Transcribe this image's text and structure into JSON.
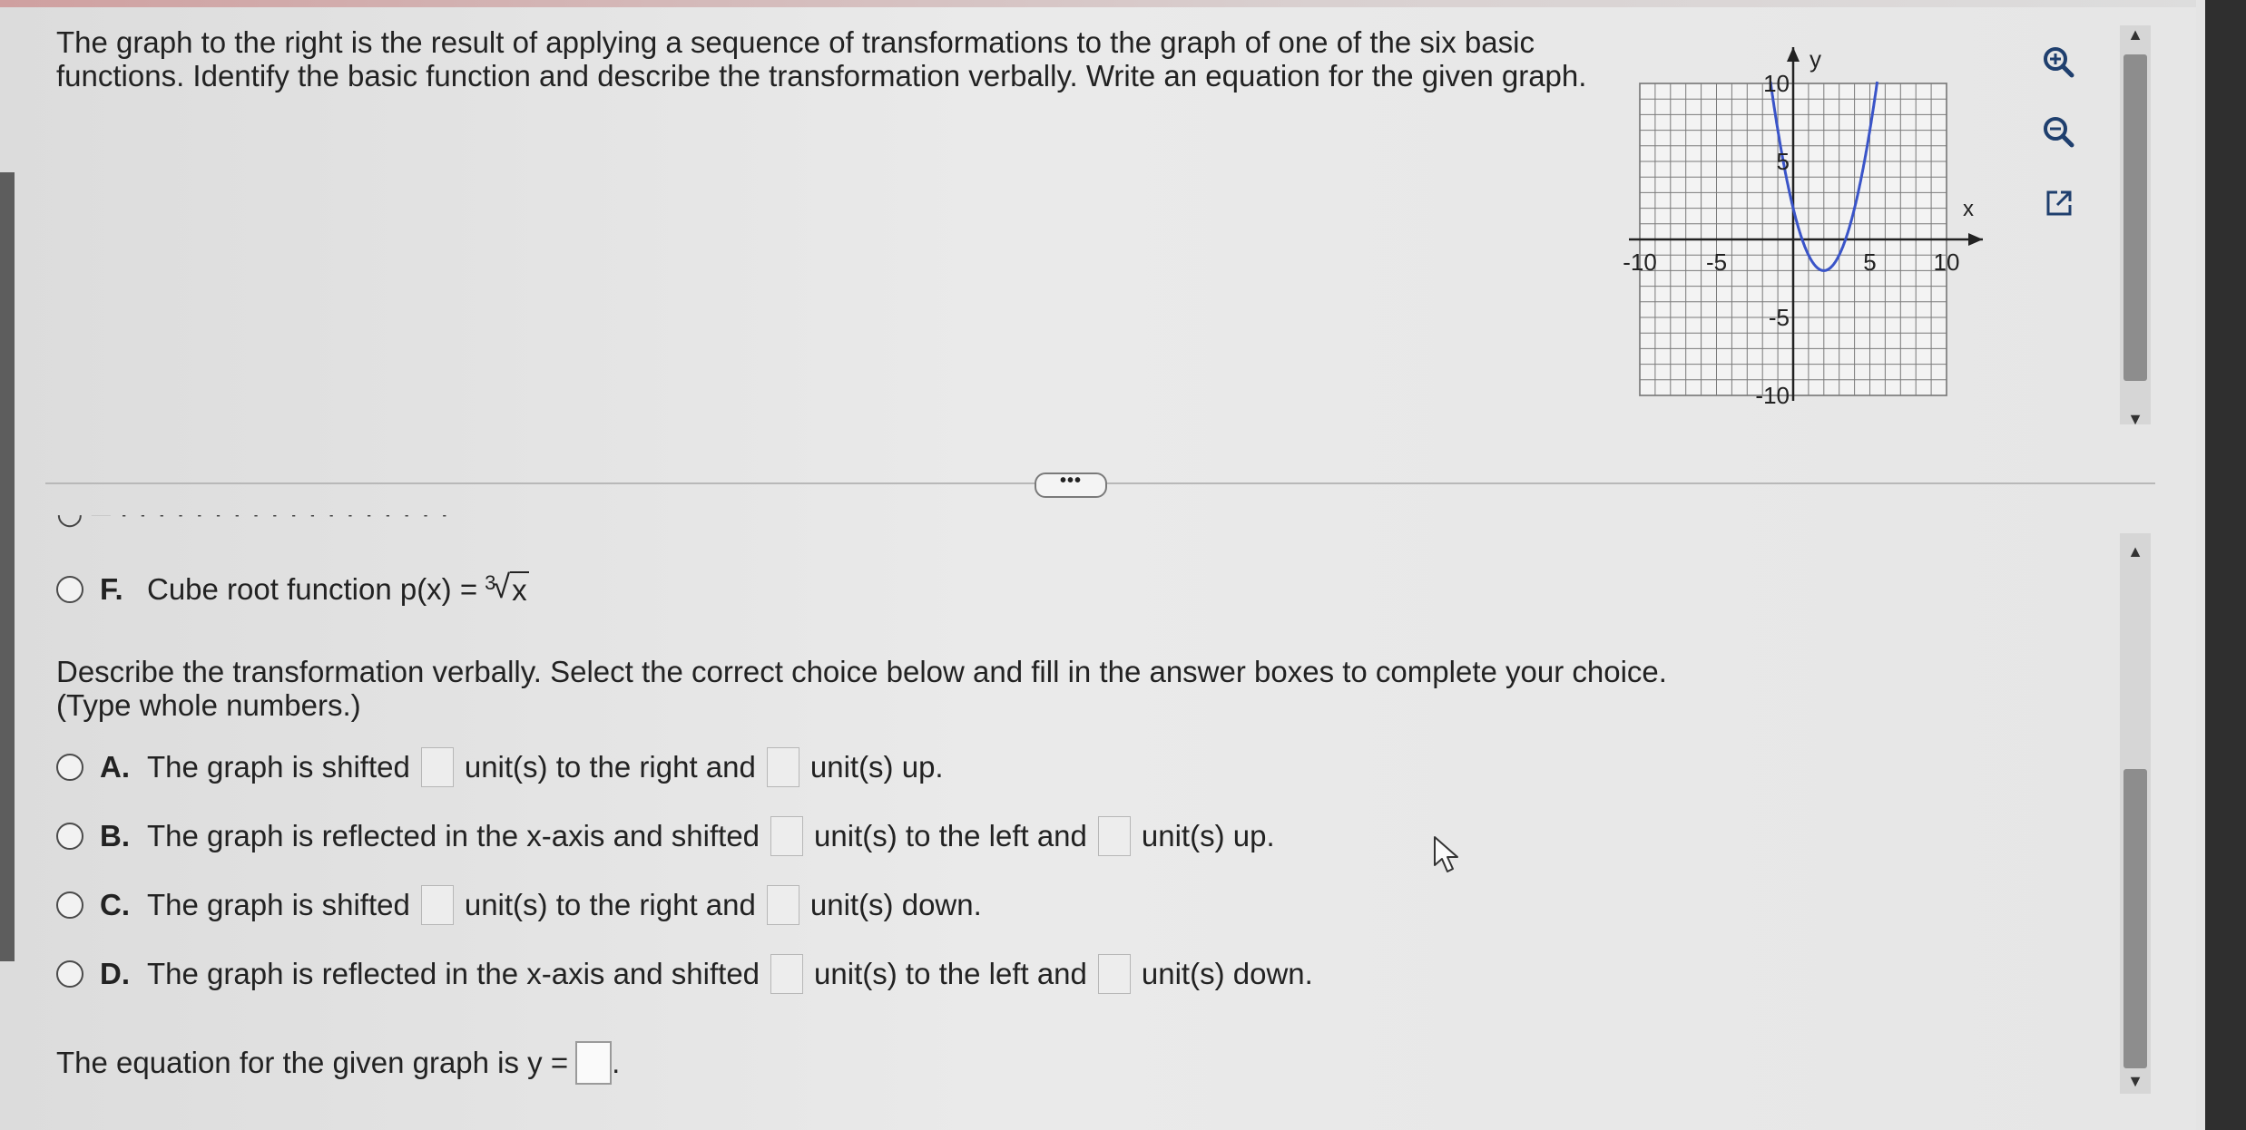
{
  "question": {
    "text": "The graph to the right is the result of applying a sequence of transformations to the graph of one of the six basic functions. Identify the basic function and describe the transformation verbally. Write an equation for the given graph."
  },
  "graph": {
    "x_label": "x",
    "y_label": "y",
    "x_ticks": [
      "-10",
      "-5",
      "5",
      "10"
    ],
    "y_ticks": [
      "10",
      "5",
      "-5",
      "-10"
    ],
    "xlim": [
      -10,
      10
    ],
    "ylim": [
      -10,
      10
    ],
    "curve_color": "#3a54c8",
    "vertex": [
      2,
      -2
    ],
    "curve": "parabola opening up"
  },
  "toolbar": {
    "zoom_in": "zoom-in-icon",
    "zoom_out": "zoom-out-icon",
    "popout": "external-link-icon"
  },
  "divider": {
    "ellipsis": "•••"
  },
  "option_f": {
    "letter": "F.",
    "label": "Cube root function p(x) =",
    "index": "3",
    "radicand": "x"
  },
  "instructions": {
    "line1": "Describe the transformation verbally. Select the correct choice below and fill in the answer boxes to complete your choice.",
    "line2": "(Type whole numbers.)"
  },
  "choices": [
    {
      "letter": "A.",
      "p1": "The graph is shifted",
      "p2": "unit(s) to the right and",
      "p3": "unit(s) up."
    },
    {
      "letter": "B.",
      "p1": "The graph is reflected in the x-axis and shifted",
      "p2": "unit(s) to the left and",
      "p3": "unit(s) up."
    },
    {
      "letter": "C.",
      "p1": "The graph is shifted",
      "p2": "unit(s) to the right and",
      "p3": "unit(s) down."
    },
    {
      "letter": "D.",
      "p1": "The graph is reflected in the x-axis and shifted",
      "p2": "unit(s) to the left and",
      "p3": "unit(s) down."
    }
  ],
  "equation": {
    "prefix": "The equation for the given graph is y =",
    "suffix": "."
  }
}
